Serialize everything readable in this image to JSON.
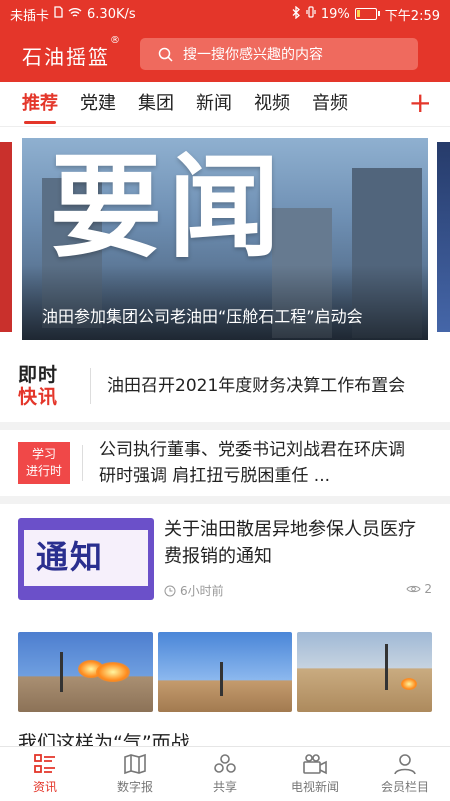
{
  "status_bar": {
    "carrier": "未插卡",
    "speed": "6.30K/s",
    "battery": "19%",
    "battery_level": 0.19,
    "time": "下午2:59"
  },
  "app": {
    "logo": "石油摇篮",
    "logo_mark": "®",
    "search_placeholder": "搜一搜你感兴趣的内容"
  },
  "tabs": [
    "推荐",
    "党建",
    "集团",
    "新闻",
    "视频",
    "音频"
  ],
  "active_tab": "推荐",
  "add_tab_icon": "plus-icon",
  "banner": {
    "big_text": "要闻",
    "caption": "油田参加集团公司老油田“压舱石工程”启动会"
  },
  "quick_news": {
    "badge_line1": "即时",
    "badge_line2": "快讯",
    "text": "油田召开2021年度财务决算工作布置会"
  },
  "study_news": {
    "badge_line1": "学习",
    "badge_line2": "进行时",
    "text": "公司执行董事、党委书记刘战君在环庆调研时强调 肩扛扭亏脱困重任 ..."
  },
  "article": {
    "thumb_text": "通知",
    "title": "关于油田散居异地参保人员医疗费报销的通知",
    "time": "6小时前",
    "views": "2"
  },
  "next_article_title": "我们这样为“气”而战",
  "bottom_nav": [
    {
      "label": "资讯",
      "icon": "news-list-icon"
    },
    {
      "label": "数字报",
      "icon": "newspaper-icon"
    },
    {
      "label": "共享",
      "icon": "share-circles-icon"
    },
    {
      "label": "电视新闻",
      "icon": "video-camera-icon"
    },
    {
      "label": "会员栏目",
      "icon": "user-icon"
    }
  ],
  "colors": {
    "accent": "#e4362a"
  }
}
